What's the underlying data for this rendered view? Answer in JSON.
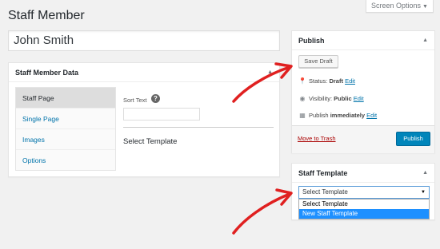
{
  "screen_options": {
    "label": "Screen Options"
  },
  "page_title": "Staff Member",
  "post_title": "John Smith",
  "staff_data": {
    "title": "Staff Member Data",
    "tabs": [
      {
        "label": "Staff Page"
      },
      {
        "label": "Single Page"
      },
      {
        "label": "Images"
      },
      {
        "label": "Options"
      }
    ],
    "sort_text_label": "Sort Text",
    "help_glyph": "?",
    "select_template_label": "Select Template"
  },
  "publish": {
    "title": "Publish",
    "save_draft": "Save Draft",
    "status_label": "Status:",
    "status_value": "Draft",
    "visibility_label": "Visibility:",
    "visibility_value": "Public",
    "publish_label": "Publish",
    "publish_value": "immediately",
    "edit_link": "Edit",
    "trash_link": "Move to Trash",
    "publish_button": "Publish"
  },
  "staff_template": {
    "title": "Staff Template",
    "selected": "Select Template",
    "options": [
      "Select Template",
      "New Staff Template"
    ],
    "highlighted_option": "New Staff Template"
  },
  "colors": {
    "annotation": "#e02020",
    "primary_button": "#0085ba",
    "link": "#0073aa",
    "trash": "#aa0000",
    "dropdown_highlight": "#1e90ff"
  }
}
